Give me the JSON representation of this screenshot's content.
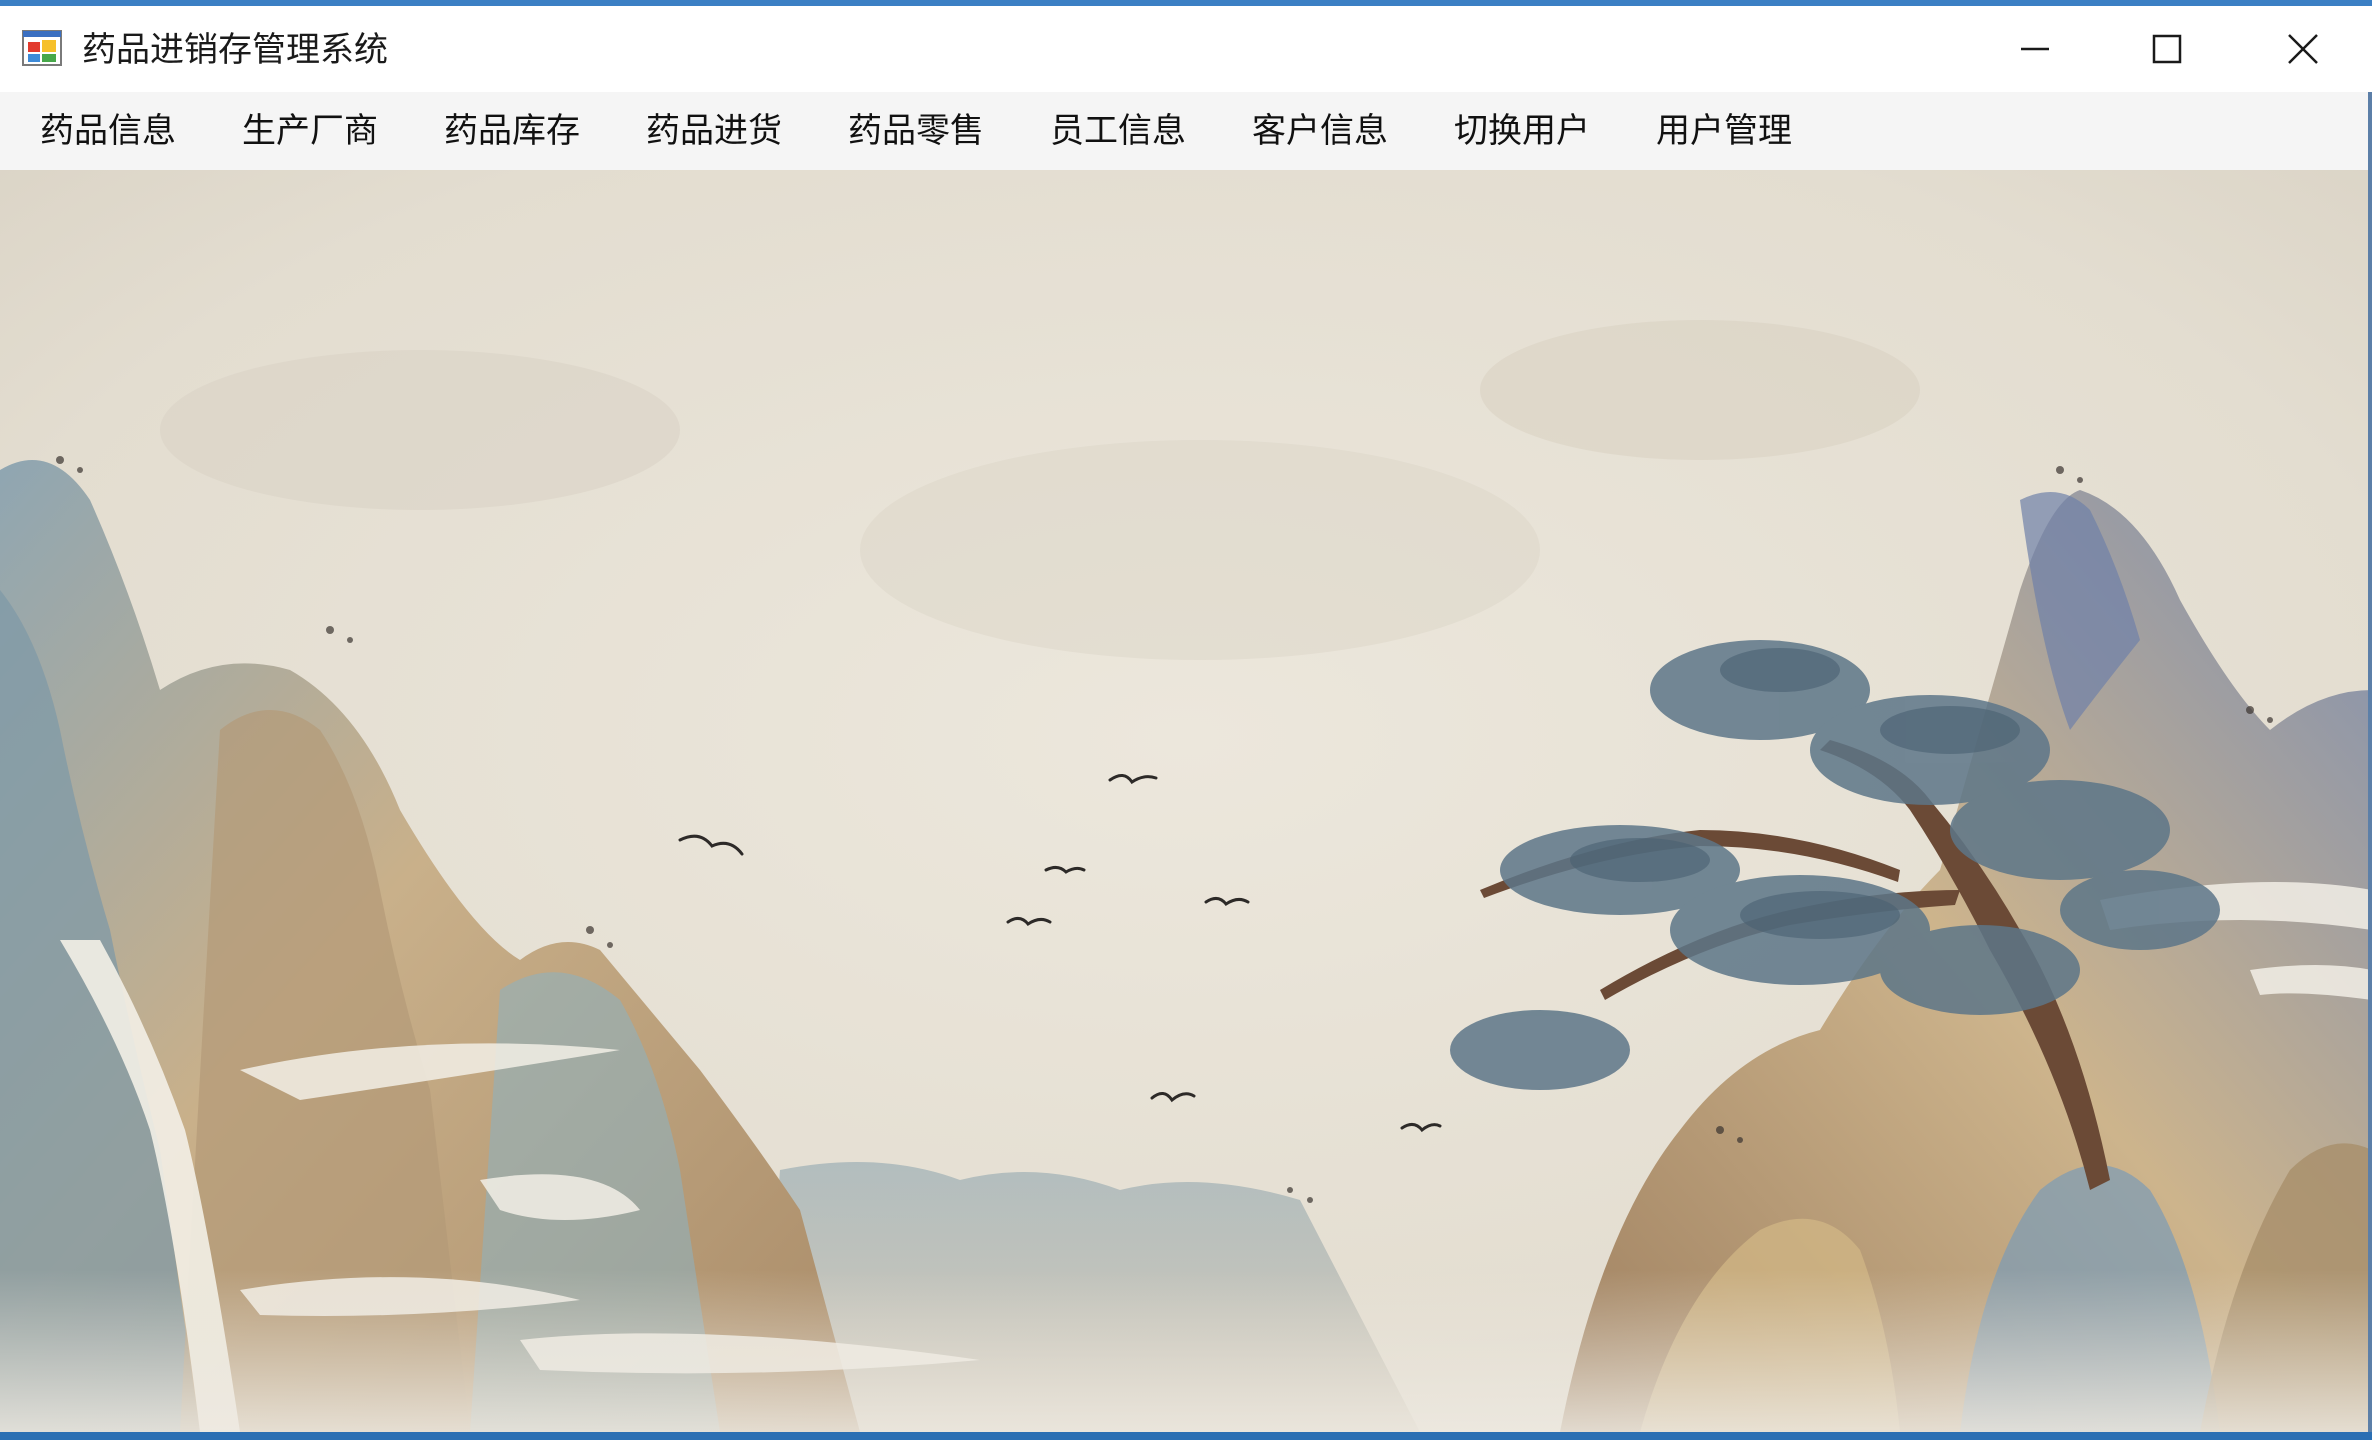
{
  "window": {
    "title": "药品进销存管理系统",
    "icon": "windows-forms-app-icon",
    "controls": {
      "minimize_icon": "minimize-icon",
      "maximize_icon": "maximize-icon",
      "close_icon": "close-icon"
    }
  },
  "menu": {
    "items": [
      {
        "label": "药品信息"
      },
      {
        "label": "生产厂商"
      },
      {
        "label": "药品库存"
      },
      {
        "label": "药品进货"
      },
      {
        "label": "药品零售"
      },
      {
        "label": "员工信息"
      },
      {
        "label": "客户信息"
      },
      {
        "label": "切换用户"
      },
      {
        "label": "用户管理"
      }
    ]
  },
  "background": {
    "description_icon": "landscape-painting-image"
  },
  "colors": {
    "title_bar": "#ffffff",
    "menu_bar": "#f5f5f5",
    "accent_border": "#2b6fb3",
    "paper": "#e6e0d4"
  }
}
